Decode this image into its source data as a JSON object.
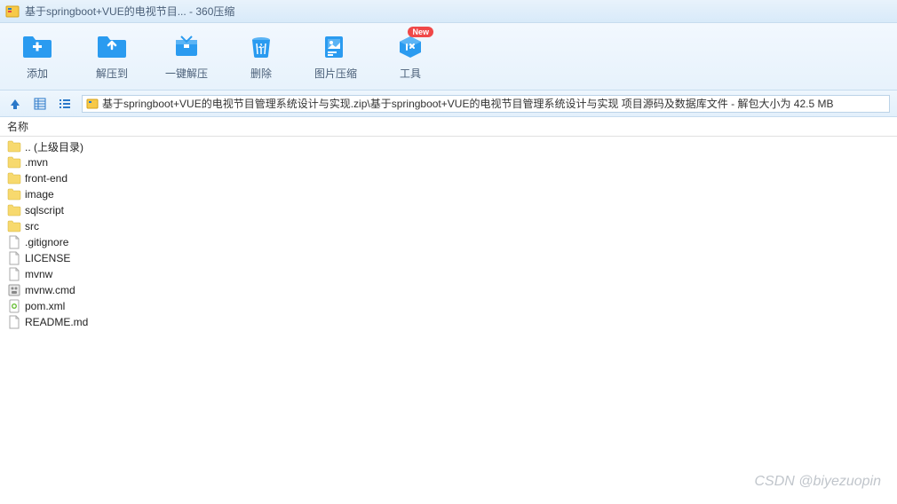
{
  "window": {
    "title": "基于springboot+VUE的电视节目... - 360压缩"
  },
  "toolbar": {
    "add": "添加",
    "extract_to": "解压到",
    "one_click_extract": "一键解压",
    "delete": "删除",
    "image_compress": "图片压缩",
    "tools": "工具",
    "new_badge": "New"
  },
  "path": {
    "text": "基于springboot+VUE的电视节目管理系统设计与实现.zip\\基于springboot+VUE的电视节目管理系统设计与实现 项目源码及数据库文件 - 解包大小为 42.5 MB"
  },
  "columns": {
    "name": "名称"
  },
  "files": [
    {
      "name": ".. (上级目录)",
      "type": "folder"
    },
    {
      "name": ".mvn",
      "type": "folder"
    },
    {
      "name": "front-end",
      "type": "folder"
    },
    {
      "name": "image",
      "type": "folder"
    },
    {
      "name": "sqlscript",
      "type": "folder"
    },
    {
      "name": "src",
      "type": "folder"
    },
    {
      "name": ".gitignore",
      "type": "file"
    },
    {
      "name": "LICENSE",
      "type": "file"
    },
    {
      "name": "mvnw",
      "type": "file"
    },
    {
      "name": "mvnw.cmd",
      "type": "cmd"
    },
    {
      "name": "pom.xml",
      "type": "xml"
    },
    {
      "name": "README.md",
      "type": "file"
    }
  ],
  "watermark": "CSDN @biyezuopin"
}
